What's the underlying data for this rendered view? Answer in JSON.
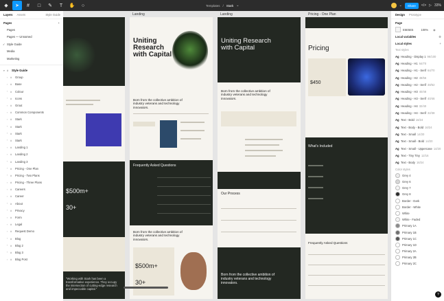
{
  "toolbar": {
    "breadcrumb_project": "Templates",
    "breadcrumb_sep": "/",
    "breadcrumb_file": "Stark",
    "share_label": "Share",
    "zoom": "33%",
    "play": "▷"
  },
  "left_panel": {
    "tab_layers": "Layers",
    "tab_assets": "Assets",
    "page_switch": "Style Guide",
    "pages_header": "Pages",
    "pages": [
      "Pages",
      "Pages — Unnamed",
      "Style Guide",
      "Media",
      "Marketing"
    ],
    "active_page": "Style Guide",
    "layers_header": "Style Guide",
    "layers": [
      "Group",
      "Base",
      "Colour",
      "Icons",
      "Grout",
      "Common Components",
      "Stark",
      "Stark",
      "Stark",
      "Stark",
      "Landing 1",
      "Landing 2",
      "Landing 3",
      "Pricing - One Plan",
      "Pricing - Two Plans",
      "Pricing - Three Plans",
      "Careers",
      "Career",
      "About",
      "Privacy",
      "Form",
      "Legal",
      "Request Demo",
      "Blog",
      "Blog 2",
      "Blog 3",
      "Blog Post"
    ]
  },
  "right_panel": {
    "tab_design": "Design",
    "tab_prototype": "Prototype",
    "page_header": "Page",
    "bg_hex": "E5E5E5",
    "bg_opacity": "100%",
    "local_variables": "Local variables",
    "local_styles": "Local styles",
    "text_styles_label": "Text styles",
    "text_styles": [
      {
        "name": "Heading - Display 1",
        "meta": "96/100"
      },
      {
        "name": "Heading - H1",
        "meta": "64/70"
      },
      {
        "name": "Heading - H1 - Serif",
        "meta": "64/70"
      },
      {
        "name": "Heading - H2",
        "meta": "48/56"
      },
      {
        "name": "Heading - H2 - Serif",
        "meta": "48/52"
      },
      {
        "name": "Heading - H3",
        "meta": "40/48"
      },
      {
        "name": "Heading - H3 - Serif",
        "meta": "40/46"
      },
      {
        "name": "Heading - H4",
        "meta": "32/40"
      },
      {
        "name": "Heading - H4 - Serif",
        "meta": "32/38"
      },
      {
        "name": "Text - Bold",
        "meta": "16/24"
      },
      {
        "name": "Text - Body - Bold",
        "meta": "16/24"
      },
      {
        "name": "Text - Small",
        "meta": "14/20"
      },
      {
        "name": "Text - Small - Bold",
        "meta": "14/20"
      },
      {
        "name": "Text - Small - Uppercase",
        "meta": "14/20"
      },
      {
        "name": "Text - Tiny Tiny",
        "meta": "12/16"
      },
      {
        "name": "Text - Body",
        "meta": "16/24"
      }
    ],
    "color_styles_label": "Color styles",
    "colors": [
      {
        "name": "Grey 4",
        "hex": "#ededed"
      },
      {
        "name": "Grey 6",
        "hex": "#d6d6d6"
      },
      {
        "name": "Grey 7",
        "hex": "#f5f5f5"
      },
      {
        "name": "Grey 8",
        "hex": "#2b2b2b"
      },
      {
        "name": "Border - Dark",
        "hex": "#ffffff"
      },
      {
        "name": "Border - White",
        "hex": "#ffffff"
      },
      {
        "name": "White",
        "hex": "#ffffff"
      },
      {
        "name": "White - Faded",
        "hex": "#f4f4f4"
      },
      {
        "name": "Primary 1A",
        "hex": "#8a8a8a"
      },
      {
        "name": "Primary 1B",
        "hex": "#6f6f6f"
      },
      {
        "name": "Primary 1C",
        "hex": "#555555"
      },
      {
        "name": "Primary 1D",
        "hex": "#ffffff"
      },
      {
        "name": "Primary 2A",
        "hex": "#ffffff"
      },
      {
        "name": "Primary 2B",
        "hex": "#ffffff"
      },
      {
        "name": "Primary 2C",
        "hex": "#ffffff"
      }
    ]
  },
  "frames": {
    "landing1_label": "Landing",
    "landing2_label": "Landing",
    "pricing_label": "Pricing - One Plan",
    "landing_headline": "Uniting Research with Capital",
    "pricing_headline": "Pricing",
    "price": "$450",
    "tagline": "Born from the collective ambition of industry veterans and technology innovators.",
    "faq_title": "Frequently Asked Questions",
    "what_included": "What's Included",
    "our_process": "Our Process",
    "stat_1": "$500m+",
    "stat_2": "30+",
    "quote": "\"Working with Stark has been a transformative experience. They occupy the intersection of cutting-edge research and impeccable capital.\""
  },
  "help_label": "?"
}
